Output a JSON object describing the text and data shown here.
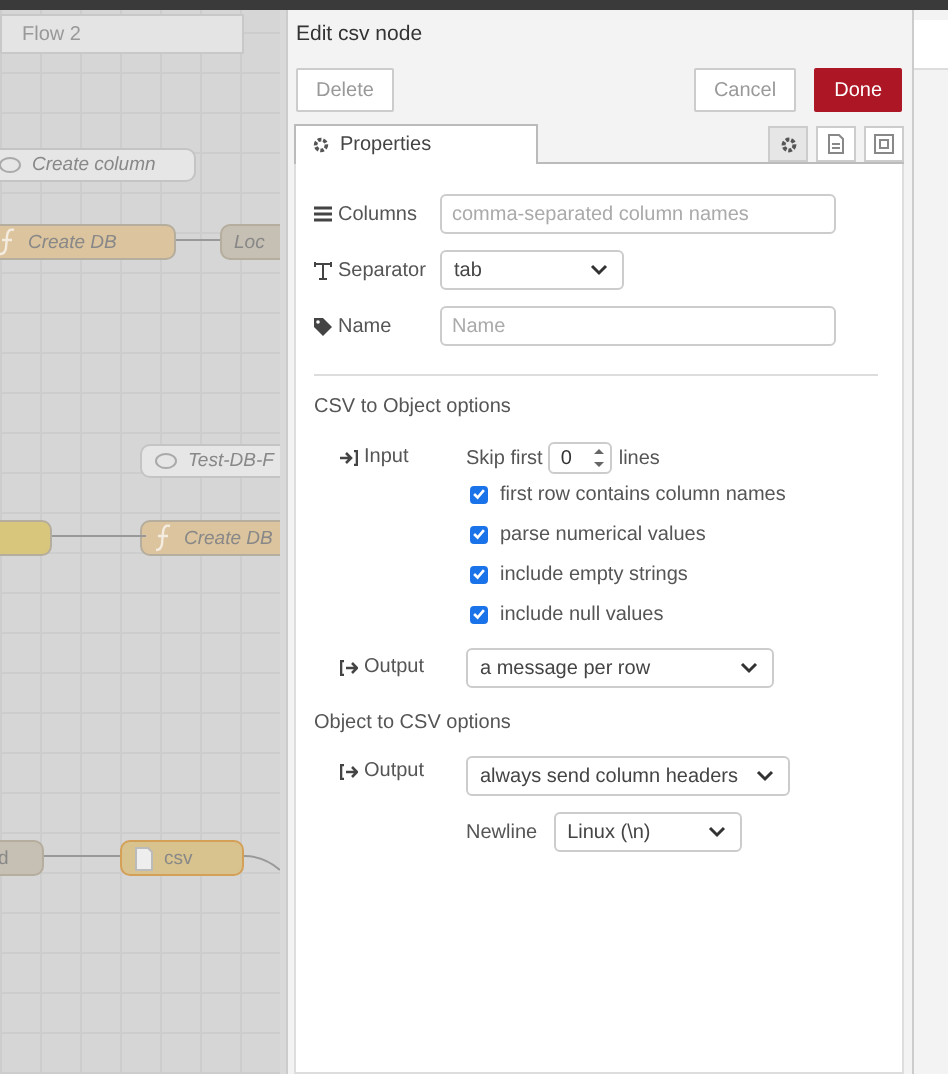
{
  "canvas": {
    "tab": "Flow 2",
    "nodes": [
      {
        "kind": "comment",
        "label": "Create column"
      },
      {
        "kind": "function",
        "label": "Create DB"
      },
      {
        "kind": "plain",
        "label": "Loc"
      },
      {
        "kind": "comment",
        "label": "Test-DB-F"
      },
      {
        "kind": "yellow"
      },
      {
        "kind": "function",
        "label": "Create DB"
      },
      {
        "kind": "plain",
        "label": "d"
      },
      {
        "kind": "csv",
        "label": "csv"
      }
    ]
  },
  "editor": {
    "title": "Edit csv node",
    "buttons": [
      {
        "kind": "plain",
        "label": "Delete"
      },
      {
        "kind": "plain",
        "label": "Cancel"
      },
      {
        "kind": "primary",
        "label": "Done"
      }
    ],
    "tab": {
      "label": "Properties",
      "selected": true
    },
    "icon_tabs": [
      {
        "kind": "gear",
        "selected": true
      },
      {
        "kind": "doc",
        "selected": false
      },
      {
        "kind": "frame",
        "selected": false
      }
    ],
    "columns": {
      "label": "Columns",
      "placeholder": "comma-separated column names"
    },
    "separator": {
      "label": "Separator",
      "value": "tab"
    },
    "name": {
      "label": "Name",
      "placeholder": "Name"
    },
    "csv_to_object": {
      "heading": "CSV to Object options",
      "input_label": "Input",
      "skip_label": "Skip first",
      "skip_value": "0",
      "lines_label": "lines",
      "options": [
        {
          "label": "first row contains column names",
          "checked": true
        },
        {
          "label": "parse numerical values",
          "checked": true
        },
        {
          "label": "include empty strings",
          "checked": true
        },
        {
          "label": "include null values",
          "checked": true
        }
      ],
      "output_label": "Output",
      "output_value": "a message per row"
    },
    "object_to_csv": {
      "heading": "Object to CSV options",
      "output_label": "Output",
      "output_value": "always send column headers",
      "newline_label": "Newline",
      "newline_value": "Linux (\\n)"
    }
  }
}
